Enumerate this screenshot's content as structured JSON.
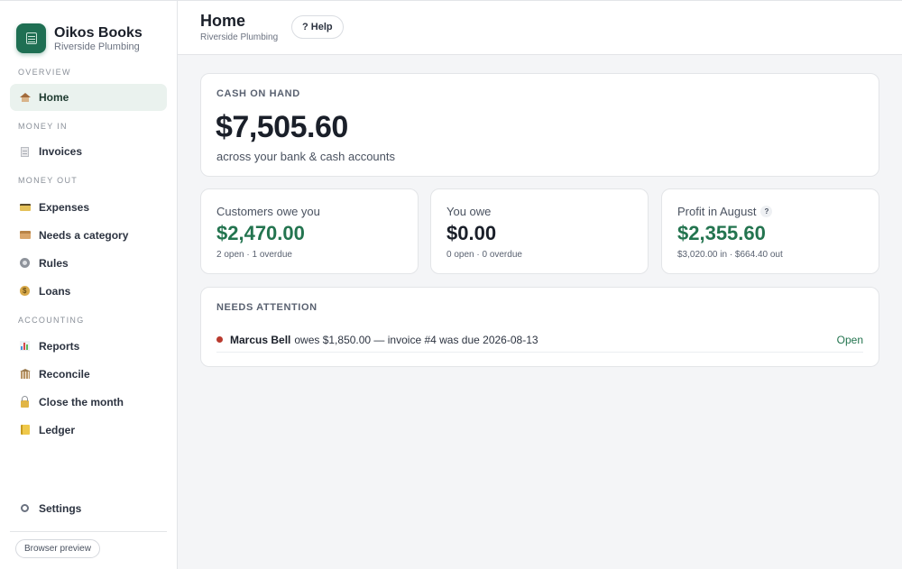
{
  "brand": {
    "name": "Oikos Books",
    "subtitle": "Riverside Plumbing",
    "icon": "ledger-book-icon"
  },
  "sidebar": {
    "sections": [
      {
        "label": "OVERVIEW",
        "items": [
          {
            "label": "Home",
            "icon": "home-icon",
            "active": true
          }
        ]
      },
      {
        "label": "MONEY IN",
        "items": [
          {
            "label": "Invoices",
            "icon": "invoice-icon"
          }
        ]
      },
      {
        "label": "MONEY OUT",
        "items": [
          {
            "label": "Expenses",
            "icon": "credit-card-icon"
          },
          {
            "label": "Needs a category",
            "icon": "box-icon"
          },
          {
            "label": "Rules",
            "icon": "gear-icon"
          },
          {
            "label": "Loans",
            "icon": "money-bag-icon"
          }
        ]
      },
      {
        "label": "ACCOUNTING",
        "items": [
          {
            "label": "Reports",
            "icon": "bar-chart-icon"
          },
          {
            "label": "Reconcile",
            "icon": "bank-icon"
          },
          {
            "label": "Close the month",
            "icon": "lock-icon"
          },
          {
            "label": "Ledger",
            "icon": "ledger-icon"
          }
        ]
      }
    ],
    "settings": {
      "label": "Settings",
      "icon": "settings-icon"
    },
    "preview_button": "Browser preview"
  },
  "header": {
    "title": "Home",
    "subtitle": "Riverside Plumbing",
    "help_label": "? Help"
  },
  "cash": {
    "label": "CASH ON HAND",
    "amount": "$7,505.60",
    "subtitle": "across your bank & cash accounts"
  },
  "stats": [
    {
      "label": "Customers owe you",
      "value": "$2,470.00",
      "meta": "2 open · 1 overdue",
      "color": "#23744f"
    },
    {
      "label": "You owe",
      "value": "$0.00",
      "meta": "0 open · 0 overdue",
      "color": "#1a1f29"
    },
    {
      "label": "Profit in August",
      "help": "?",
      "value": "$2,355.60",
      "meta": "$3,020.00 in · $664.40 out",
      "color": "#23744f"
    }
  ],
  "attention": {
    "label": "NEEDS ATTENTION",
    "items": [
      {
        "name": "Marcus Bell",
        "text": "owes $1,850.00 — invoice #4 was due 2026-08-13",
        "status": "Open",
        "dot_color": "#b93a2e"
      }
    ]
  },
  "colors": {
    "accent": "#1f6f53",
    "positive": "#23744f",
    "active_bg": "#eaf2ee",
    "alert": "#b93a2e"
  }
}
